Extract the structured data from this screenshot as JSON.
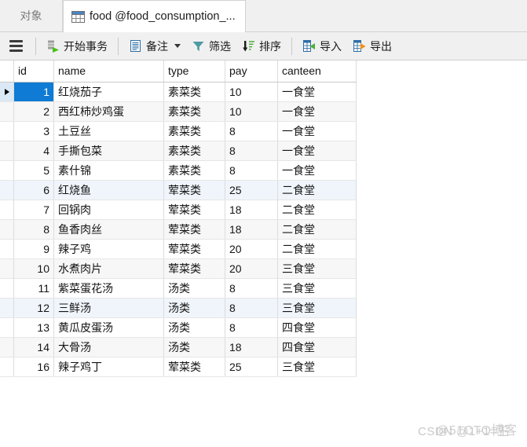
{
  "tabs": [
    {
      "label": "对象",
      "active": false,
      "icon": null
    },
    {
      "label": "food @food_consumption_...",
      "active": true,
      "icon": "table-grid-icon"
    }
  ],
  "toolbar": {
    "menu_icon": "hamburger-menu-icon",
    "buttons": [
      {
        "label": "开始事务",
        "icon": "start-transaction-icon",
        "dropdown": false
      },
      {
        "label": "备注",
        "icon": "note-icon",
        "dropdown": true
      },
      {
        "label": "筛选",
        "icon": "filter-funnel-icon",
        "dropdown": false
      },
      {
        "label": "排序",
        "icon": "sort-descending-icon",
        "dropdown": false
      },
      {
        "label": "导入",
        "icon": "import-icon",
        "dropdown": false
      },
      {
        "label": "导出",
        "icon": "export-icon",
        "dropdown": false
      }
    ]
  },
  "grid": {
    "columns": [
      "id",
      "name",
      "type",
      "pay",
      "canteen"
    ],
    "selected_row_index": 0,
    "highlight_rows": [
      5,
      11
    ],
    "rows": [
      {
        "id": "1",
        "name": "红烧茄子",
        "type": "素菜类",
        "pay": "10",
        "canteen": "一食堂"
      },
      {
        "id": "2",
        "name": "西红柿炒鸡蛋",
        "type": "素菜类",
        "pay": "10",
        "canteen": "一食堂"
      },
      {
        "id": "3",
        "name": "土豆丝",
        "type": "素菜类",
        "pay": "8",
        "canteen": "一食堂"
      },
      {
        "id": "4",
        "name": "手撕包菜",
        "type": "素菜类",
        "pay": "8",
        "canteen": "一食堂"
      },
      {
        "id": "5",
        "name": "素什锦",
        "type": "素菜类",
        "pay": "8",
        "canteen": "一食堂"
      },
      {
        "id": "6",
        "name": "红烧鱼",
        "type": "荤菜类",
        "pay": "25",
        "canteen": "二食堂"
      },
      {
        "id": "7",
        "name": "回锅肉",
        "type": "荤菜类",
        "pay": "18",
        "canteen": "二食堂"
      },
      {
        "id": "8",
        "name": "鱼香肉丝",
        "type": "荤菜类",
        "pay": "18",
        "canteen": "二食堂"
      },
      {
        "id": "9",
        "name": "辣子鸡",
        "type": "荤菜类",
        "pay": "20",
        "canteen": "二食堂"
      },
      {
        "id": "10",
        "name": "水煮肉片",
        "type": "荤菜类",
        "pay": "20",
        "canteen": "三食堂"
      },
      {
        "id": "11",
        "name": "紫菜蛋花汤",
        "type": "汤类",
        "pay": "8",
        "canteen": "三食堂"
      },
      {
        "id": "12",
        "name": "三鲜汤",
        "type": "汤类",
        "pay": "8",
        "canteen": "三食堂"
      },
      {
        "id": "13",
        "name": "黄瓜皮蛋汤",
        "type": "汤类",
        "pay": "8",
        "canteen": "四食堂"
      },
      {
        "id": "14",
        "name": "大骨汤",
        "type": "汤类",
        "pay": "18",
        "canteen": "四食堂"
      },
      {
        "id": "16",
        "name": "辣子鸡丁",
        "type": "荤菜类",
        "pay": "25",
        "canteen": "三食堂"
      }
    ]
  },
  "watermarks": [
    {
      "text": "CSDN @1+1=王"
    },
    {
      "text": "@51CTO博客"
    }
  ],
  "colors": {
    "selection_blue": "#0f7bd4",
    "header_highlight": "#dbe9f7",
    "row_alt": "#f7f7f7",
    "row_highlight": "#eff5fb",
    "chrome_gray": "#f0f0f0"
  }
}
